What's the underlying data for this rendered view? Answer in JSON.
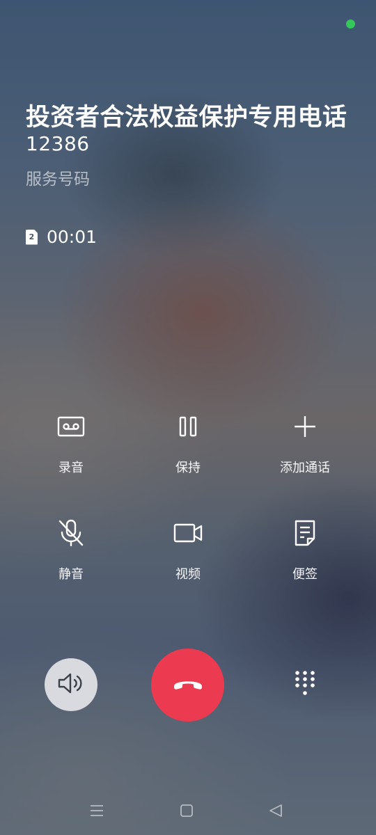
{
  "status_bar": {
    "indicator_color": "#34c759"
  },
  "caller": {
    "name": "投资者合法权益保护专用电话",
    "number": "12386",
    "type": "服务号码"
  },
  "call": {
    "sim_slot": "2",
    "timer": "00:01"
  },
  "actions": [
    {
      "label": "录音",
      "icon": "record-icon"
    },
    {
      "label": "保持",
      "icon": "pause-icon"
    },
    {
      "label": "添加通话",
      "icon": "plus-icon"
    },
    {
      "label": "静音",
      "icon": "mic-off-icon"
    },
    {
      "label": "视频",
      "icon": "video-icon"
    },
    {
      "label": "便签",
      "icon": "note-icon"
    }
  ],
  "bottom_controls": {
    "speaker_icon": "speaker-icon",
    "end_call_icon": "end-call-icon",
    "end_call_color": "#ec3b50",
    "keypad_icon": "keypad-icon"
  },
  "nav": {
    "menu_icon": "menu-icon",
    "home_icon": "home-icon",
    "back_icon": "back-icon"
  }
}
